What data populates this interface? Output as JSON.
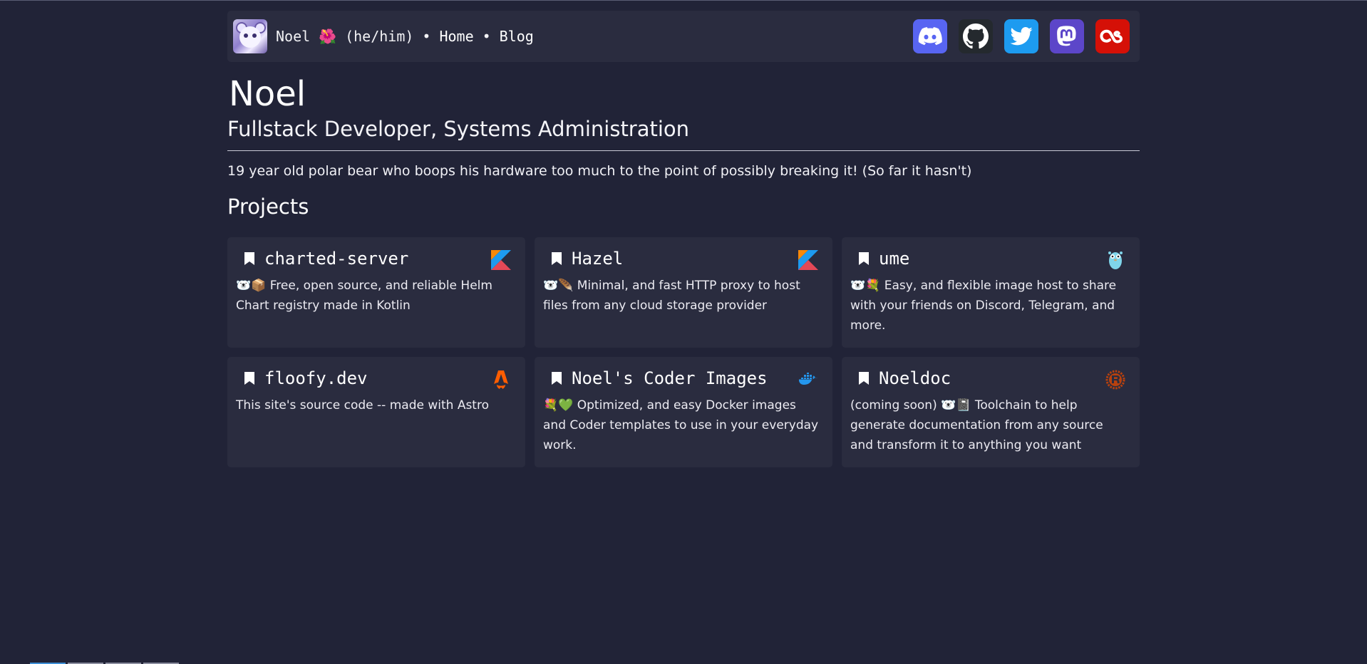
{
  "nav": {
    "name": "Noel",
    "flower": "🌺",
    "pronouns": "(he/him)",
    "sep": "•",
    "home": "Home",
    "blog": "Blog"
  },
  "socials": [
    {
      "name": "discord",
      "color": "#5865f2"
    },
    {
      "name": "github",
      "color": "#24292e"
    },
    {
      "name": "twitter",
      "color": "#1d9bf0"
    },
    {
      "name": "mastodon",
      "color": "#5c46c9"
    },
    {
      "name": "lastfm",
      "color": "#d51007"
    }
  ],
  "header": {
    "title": "Noel",
    "subtitle": "Fullstack Developer, Systems Administration",
    "bio": "19 year old polar bear who boops his hardware too much to the point of possibly breaking it! (So far it hasn't)"
  },
  "projects": {
    "heading": "Projects",
    "items": [
      {
        "title": "charted-server",
        "description": "🐻‍❄️📦 Free, open source, and reliable Helm Chart registry made in Kotlin",
        "lang_icon": "kotlin-icon"
      },
      {
        "title": "Hazel",
        "description": "🐻‍❄️🪶 Minimal, and fast HTTP proxy to host files from any cloud storage provider",
        "lang_icon": "kotlin-icon"
      },
      {
        "title": "ume",
        "description": "🐻‍❄️💐 Easy, and flexible image host to share with your friends on Discord, Telegram, and more.",
        "lang_icon": "go-icon"
      },
      {
        "title": "floofy.dev",
        "description": "This site's source code -- made with Astro",
        "lang_icon": "astro-icon"
      },
      {
        "title": "Noel's Coder Images",
        "description": "💐💚 Optimized, and easy Docker images and Coder templates to use in your everyday work.",
        "lang_icon": "docker-icon"
      },
      {
        "title": "Noeldoc",
        "description": "(coming soon) 🐻‍❄️📓 Toolchain to help generate documentation from any source and transform it to anything you want",
        "lang_icon": "rust-icon"
      }
    ]
  }
}
